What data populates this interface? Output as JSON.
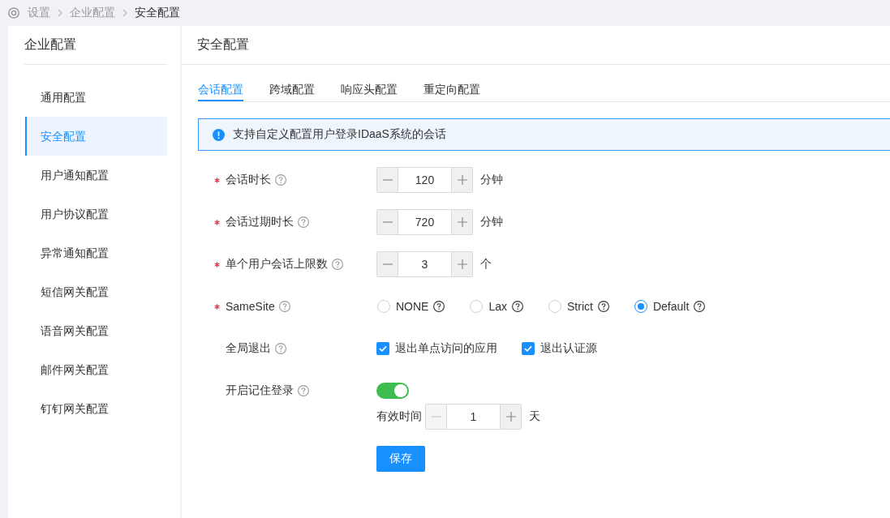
{
  "breadcrumb": [
    {
      "label": "设置",
      "current": false
    },
    {
      "label": "企业配置",
      "current": false
    },
    {
      "label": "安全配置",
      "current": true
    }
  ],
  "sidebar": {
    "title": "企业配置",
    "items": [
      {
        "label": "通用配置",
        "selected": false
      },
      {
        "label": "安全配置",
        "selected": true
      },
      {
        "label": "用户通知配置",
        "selected": false
      },
      {
        "label": "用户协议配置",
        "selected": false
      },
      {
        "label": "异常通知配置",
        "selected": false
      },
      {
        "label": "短信网关配置",
        "selected": false
      },
      {
        "label": "语音网关配置",
        "selected": false
      },
      {
        "label": "邮件网关配置",
        "selected": false
      },
      {
        "label": "钉钉网关配置",
        "selected": false
      }
    ]
  },
  "panel": {
    "title": "安全配置",
    "tabs": [
      {
        "label": "会话配置",
        "selected": true
      },
      {
        "label": "跨域配置",
        "selected": false
      },
      {
        "label": "响应头配置",
        "selected": false
      },
      {
        "label": "重定向配置",
        "selected": false
      }
    ],
    "alert": {
      "text": "支持自定义配置用户登录IDaaS系统的会话"
    },
    "form": {
      "fields": [
        {
          "kind": "stepper",
          "label": "会话时长",
          "required": true,
          "value": "120",
          "unit": "分钟",
          "decrement_disabled": false
        },
        {
          "kind": "stepper",
          "label": "会话过期时长",
          "required": true,
          "value": "720",
          "unit": "分钟",
          "decrement_disabled": false
        },
        {
          "kind": "stepper",
          "label": "单个用户会话上限数",
          "required": true,
          "value": "3",
          "unit": "个",
          "decrement_disabled": false
        },
        {
          "kind": "radio",
          "label": "SameSite",
          "required": true,
          "options": [
            {
              "label": "NONE",
              "selected": false
            },
            {
              "label": "Lax",
              "selected": false
            },
            {
              "label": "Strict",
              "selected": false
            },
            {
              "label": "Default",
              "selected": true
            }
          ]
        },
        {
          "kind": "checkbox",
          "label": "全局退出",
          "required": false,
          "options": [
            {
              "label": "退出单点访问的应用",
              "checked": true
            },
            {
              "label": "退出认证源",
              "checked": true
            }
          ]
        },
        {
          "kind": "switch",
          "label": "开启记住登录",
          "required": false,
          "on": true,
          "duration": {
            "label": "有效时间",
            "value": "1",
            "unit": "天",
            "decrement_disabled": true
          }
        }
      ]
    },
    "save_button": "保存"
  }
}
